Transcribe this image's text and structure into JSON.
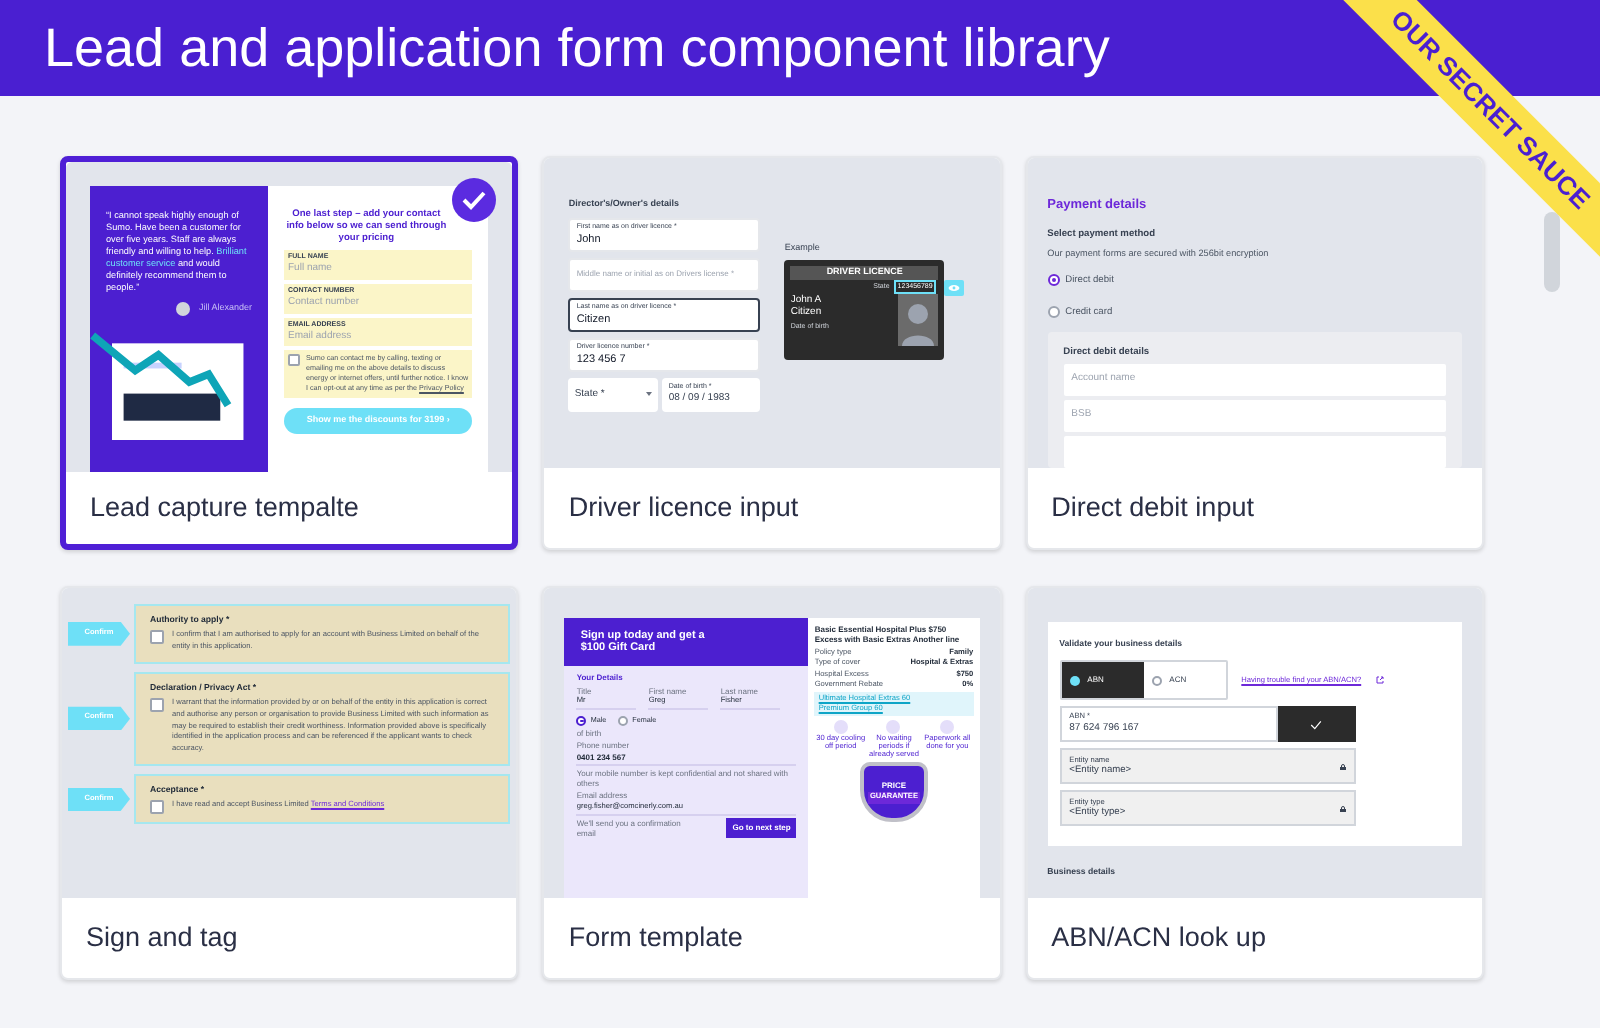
{
  "title": "Lead and application form component library",
  "ribbon": "OUR SECRET SAUCE",
  "cards": [
    {
      "kind": "lead",
      "title": "Lead capture tempalte",
      "selected": true,
      "quote_before": "“I cannot speak highly enough of Sumo. Have been a customer for over five years. Staff are always friendly and willing to help.",
      "quote_highlight": "Brilliant customer service",
      "quote_after": "and would definitely recommend them to people.”",
      "author": "Jill Alexander",
      "heading": "One last step – add your contact info below so we can send through your pricing",
      "fields": [
        {
          "label": "FULL NAME",
          "placeholder": "Full name"
        },
        {
          "label": "CONTACT NUMBER",
          "placeholder": "Contact number"
        },
        {
          "label": "EMAIL ADDRESS",
          "placeholder": "Email address"
        }
      ],
      "consent": "Sumo can contact me by calling, texting or emailing me on the above details to discuss energy or internet offers, until further notice. I know I can opt-out at any time as per the",
      "consent_link": "Privacy Policy",
      "consent_checked": false,
      "button": "Show me the discounts for 3199 ›"
    },
    {
      "kind": "licence",
      "title": "Driver licence input",
      "selected": false,
      "heading": "Director's/Owner's details",
      "fields": [
        {
          "label": "First name as on driver licence *",
          "value": "John",
          "focused": false
        },
        {
          "placeholder": "Middle name or initial as on Drivers license *",
          "focused": false
        },
        {
          "label": "Last name as on driver licence *",
          "value": "Citizen",
          "focused": true
        },
        {
          "label": "Driver licence number *",
          "value": "123 456 7",
          "focused": false
        }
      ],
      "state_select": "State *",
      "dob_label": "Date of birth *",
      "dob_value": "08 / 09 / 1983",
      "example_label": "Example",
      "licence": {
        "title": "DRIVER LICENCE",
        "state": "State",
        "number": "123456789",
        "name_first": "John A",
        "name_last": "Citizen",
        "dob": "Date of birth"
      }
    },
    {
      "kind": "debit",
      "title": "Direct debit input",
      "heading": "Payment details",
      "method_label": "Select payment method",
      "method_note": "Our payment forms are secured with 256bit encryption",
      "methods": [
        {
          "label": "Direct debit",
          "selected": true
        },
        {
          "label": "Credit card",
          "selected": false
        }
      ],
      "box_heading": "Direct debit details",
      "fields": [
        {
          "placeholder": "Account name"
        },
        {
          "placeholder": "BSB"
        }
      ],
      "more_below": true,
      "selected": false
    },
    {
      "kind": "sign",
      "title": "Sign and tag",
      "selected": false,
      "items": [
        {
          "tag": "Confirm",
          "heading": "Authority to apply *",
          "text": "I confirm that I am authorised to apply for an account with Business Limited on behalf of the entity in this application.",
          "checked": false
        },
        {
          "tag": "Confirm",
          "heading": "Declaration / Privacy Act *",
          "text": "I warrant that the information provided by or on behalf of the entity in this application is correct and authorise any person or organisation to provide Business Limited with such information as may be required to establish their credit worthiness. Information provided above is specifically identified in the application process and can be referenced if the applicant wants to check accuracy.",
          "checked": false
        },
        {
          "tag": "Confirm",
          "heading": "Acceptance *",
          "text": "I have read and accept Business Limited",
          "link": "Terms and Conditions",
          "checked": false
        }
      ]
    },
    {
      "kind": "template",
      "title": "Form template",
      "selected": false,
      "banner": "Sign up today and get a $100 Gift Card",
      "section": "Your Details",
      "name_fields": [
        {
          "label": "Title",
          "value": "Mr"
        },
        {
          "label": "First name",
          "value": "Greg"
        },
        {
          "label": "Last name",
          "value": "Fisher"
        }
      ],
      "genders": [
        {
          "label": "Male",
          "selected": true
        },
        {
          "label": "Female",
          "selected": false
        }
      ],
      "dob_label": "of birth",
      "phone_label": "Phone number",
      "phone": "0401 234 567",
      "phone_hint": "Your mobile number is kept confidential and not shared with others",
      "email_label": "Email address",
      "email": "greg.fisher@comcinerly.com.au",
      "email_hint": "We'll send you a confirmation email",
      "button": "Go to next step",
      "plan": "Basic Essential Hospital Plus $750 Excess with Basic Extras Another line",
      "details": [
        {
          "key": "Policy type",
          "value": "Family"
        },
        {
          "key": "Type of cover",
          "value": "Hospital & Extras"
        },
        {
          "key": "Hospital Excess",
          "value": "$750"
        },
        {
          "key": "Government Rebate",
          "value": "0%"
        }
      ],
      "links": [
        "Ultimate Hospital Extras 60",
        "Premium Group 60"
      ],
      "features": [
        "30 day cooling off period",
        "No waiting periods if already served",
        "Paperwork all done for you"
      ],
      "badge_top": "PRICE",
      "badge_bottom": "GUARANTEE"
    },
    {
      "kind": "abn",
      "title": "ABN/ACN look up",
      "selected": false,
      "heading": "Validate your business details",
      "options": [
        {
          "label": "ABN",
          "selected": true
        },
        {
          "label": "ACN",
          "selected": false
        }
      ],
      "help_link": "Having trouble find your ABN/ACN?",
      "abn_label": "ABN *",
      "abn_value": "87 624 796 167",
      "locked": [
        {
          "label": "Entity name",
          "value": "<Entity name>"
        },
        {
          "label": "Entity type",
          "value": "<Entity type>"
        }
      ],
      "section": "Business details"
    }
  ]
}
